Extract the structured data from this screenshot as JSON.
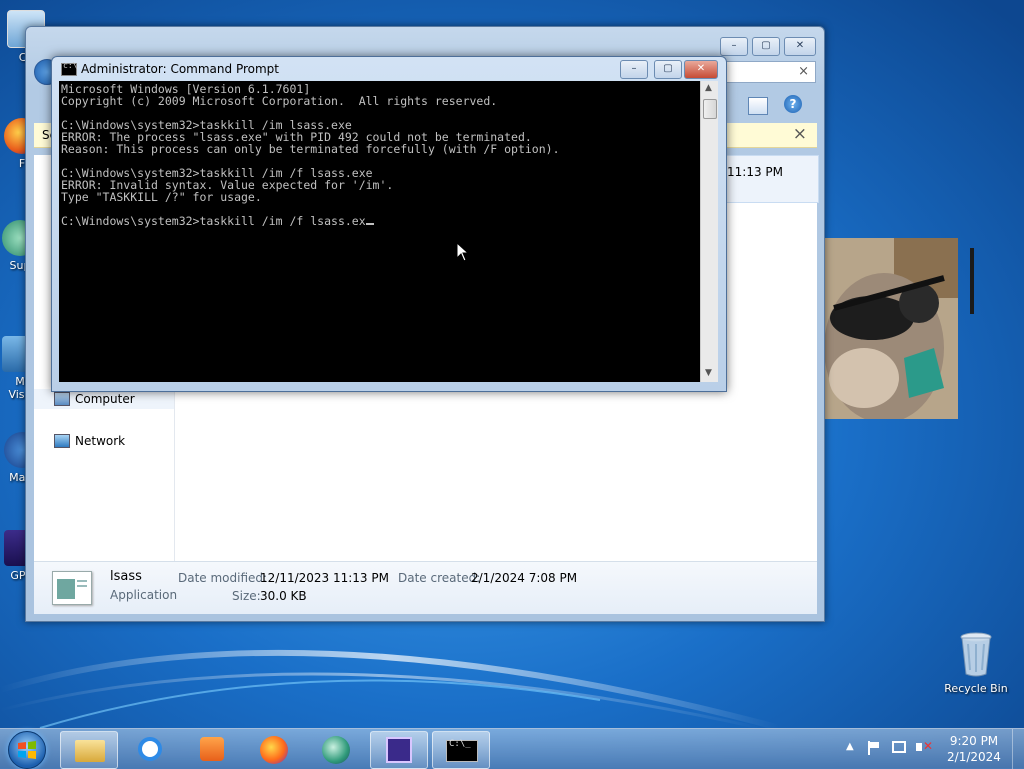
{
  "desktop": {
    "icons_left": [
      {
        "label": "Co",
        "icon": "computer-icon"
      },
      {
        "label": "F",
        "icon": "firefox-shortcut-icon"
      },
      {
        "label": "Sup",
        "icon": "shortcut-icon"
      },
      {
        "label": "M",
        "label2": "Visu",
        "icon": "shortcut-icon"
      },
      {
        "label": "Malv",
        "icon": "shortcut-icon"
      },
      {
        "label": "GPU",
        "icon": "gpu-icon"
      }
    ],
    "recycle_bin": {
      "label": "Recycle Bin",
      "icon": "recycle-bin-icon"
    }
  },
  "explorer": {
    "notification_text": "Se",
    "list_time": "11:13 PM",
    "nav": {
      "computer": "Computer",
      "network": "Network"
    },
    "details": {
      "name": "lsass",
      "type": "Application",
      "modified_label": "Date modified:",
      "modified_value": "12/11/2023 11:13 PM",
      "size_label": "Size:",
      "size_value": "30.0 KB",
      "created_label": "Date created:",
      "created_value": "2/1/2024 7:08 PM"
    },
    "close_x": "×",
    "notif_close_x": "×"
  },
  "cmd": {
    "title": "Administrator:  Command Prompt",
    "lines": [
      "Microsoft Windows [Version 6.1.7601]",
      "Copyright (c) 2009 Microsoft Corporation.  All rights reserved.",
      "",
      "C:\\Windows\\system32>taskkill /im lsass.exe",
      "ERROR: The process \"lsass.exe\" with PID 492 could not be terminated.",
      "Reason: This process can only be terminated forcefully (with /F option).",
      "",
      "C:\\Windows\\system32>taskkill /im /f lsass.exe",
      "ERROR: Invalid syntax. Value expected for '/im'.",
      "Type \"TASKKILL /?\" for usage.",
      "",
      "C:\\Windows\\system32>taskkill /im /f lsass.ex"
    ]
  },
  "taskbar": {
    "time": "9:20 PM",
    "date": "2/1/2024",
    "pinned": [
      {
        "name": "start-button"
      },
      {
        "name": "taskbar-explorer-button",
        "icon": "folder-icon"
      },
      {
        "name": "taskbar-ie-button",
        "icon": "internet-explorer-icon"
      },
      {
        "name": "taskbar-media-player-button",
        "icon": "media-player-icon"
      },
      {
        "name": "taskbar-firefox-button",
        "icon": "firefox-icon"
      },
      {
        "name": "taskbar-app-button",
        "icon": "app-icon"
      },
      {
        "name": "taskbar-process-hacker-button",
        "icon": "process-icon"
      },
      {
        "name": "taskbar-cmd-button",
        "icon": "cmd-icon"
      }
    ]
  },
  "colors": {
    "desktop_blue": "#1565b8",
    "console_bg": "#000000",
    "console_text": "#c0c0c0",
    "close_red": "#c64b34"
  }
}
